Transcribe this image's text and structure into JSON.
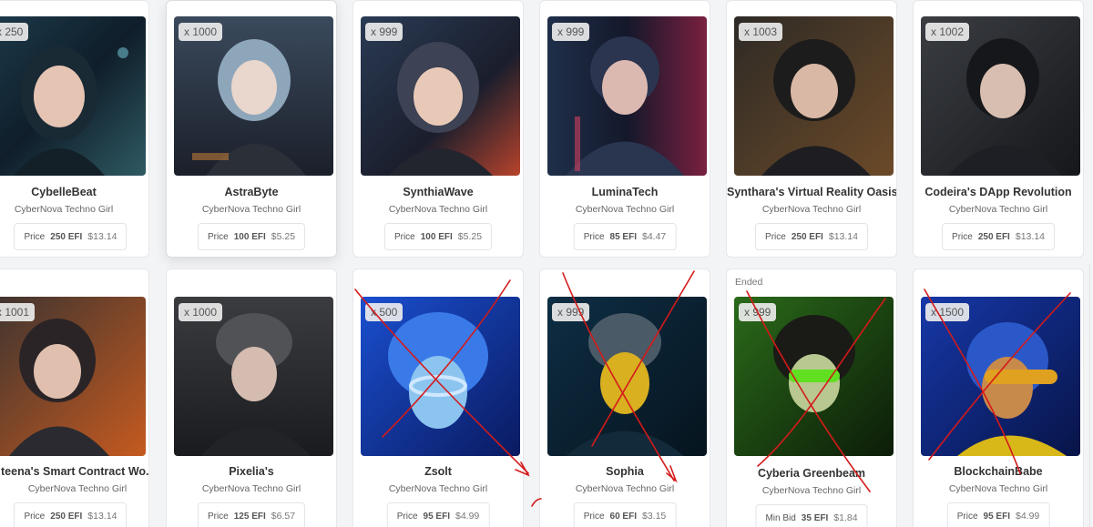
{
  "cards": [
    {
      "qty": "x 250",
      "title": "CybelleBeat",
      "collection": "CyberNova Techno Girl",
      "price_label": "Price",
      "amount": "250 EFI",
      "usd": "$13.14"
    },
    {
      "qty": "x 1000",
      "title": "AstraByte",
      "collection": "CyberNova Techno Girl",
      "price_label": "Price",
      "amount": "100 EFI",
      "usd": "$5.25"
    },
    {
      "qty": "x 999",
      "title": "SynthiaWave",
      "collection": "CyberNova Techno Girl",
      "price_label": "Price",
      "amount": "100 EFI",
      "usd": "$5.25"
    },
    {
      "qty": "x 999",
      "title": "LuminaTech",
      "collection": "CyberNova Techno Girl",
      "price_label": "Price",
      "amount": "85 EFI",
      "usd": "$4.47"
    },
    {
      "qty": "x 1003",
      "title": "Synthara's Virtual Reality Oasis",
      "collection": "CyberNova Techno Girl",
      "price_label": "Price",
      "amount": "250 EFI",
      "usd": "$13.14"
    },
    {
      "qty": "x 1002",
      "title": "Codeira's DApp Revolution",
      "collection": "CyberNova Techno Girl",
      "price_label": "Price",
      "amount": "250 EFI",
      "usd": "$13.14"
    },
    {
      "qty": "x 1001",
      "title": "teena's Smart Contract Wo...",
      "collection": "CyberNova Techno Girl",
      "price_label": "Price",
      "amount": "250 EFI",
      "usd": "$13.14"
    },
    {
      "qty": "x 1000",
      "title": "Pixelia's",
      "collection": "CyberNova Techno Girl",
      "price_label": "Price",
      "amount": "125 EFI",
      "usd": "$6.57"
    },
    {
      "qty": "x 500",
      "title": "Zsolt",
      "collection": "CyberNova Techno Girl",
      "price_label": "Price",
      "amount": "95 EFI",
      "usd": "$4.99"
    },
    {
      "qty": "x 999",
      "title": "Sophia",
      "collection": "CyberNova Techno Girl",
      "price_label": "Price",
      "amount": "60 EFI",
      "usd": "$3.15"
    },
    {
      "status": "Ended",
      "qty": "x 999",
      "title": "Cyberia Greenbeam",
      "collection": "CyberNova Techno Girl",
      "price_label": "Min Bid",
      "amount": "35 EFI",
      "usd": "$1.84"
    },
    {
      "qty": "x 1500",
      "title": "BlockchainBabe",
      "collection": "CyberNova Techno Girl",
      "price_label": "Price",
      "amount": "95 EFI",
      "usd": "$4.99"
    }
  ],
  "colors": {
    "text": "#333333",
    "border": "#e6e7ea",
    "annotation": "#d41a1a"
  }
}
